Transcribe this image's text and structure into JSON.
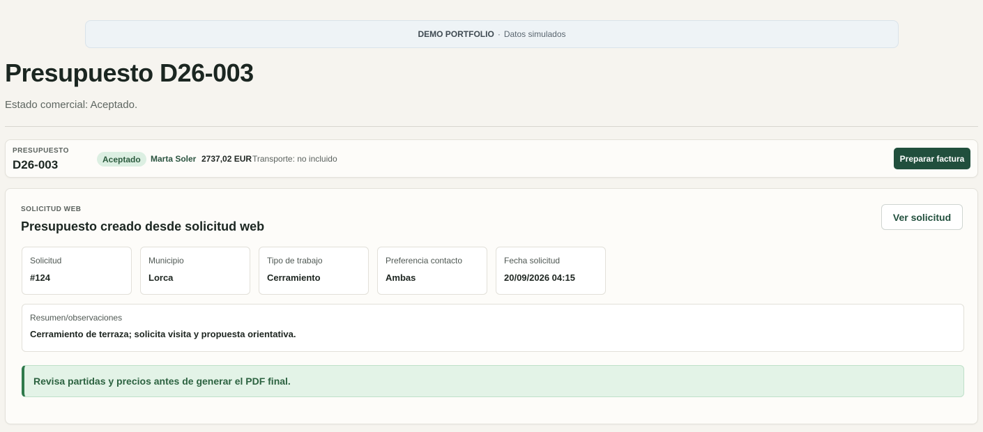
{
  "banner": {
    "strong": "DEMO PORTFOLIO",
    "separator": "·",
    "text": "Datos simulados"
  },
  "header": {
    "title": "Presupuesto D26-003",
    "subtitle": "Estado comercial: Aceptado."
  },
  "summary": {
    "kicker": "PRESUPUESTO",
    "code": "D26-003",
    "status": "Aceptado",
    "client": "Marta Soler",
    "amount": "2737,02 EUR",
    "transport": "Transporte: no incluido",
    "action_label": "Preparar factura"
  },
  "request": {
    "kicker": "SOLICITUD WEB",
    "title": "Presupuesto creado desde solicitud web",
    "action_label": "Ver solicitud",
    "fields": [
      {
        "label": "Solicitud",
        "value": "#124"
      },
      {
        "label": "Municipio",
        "value": "Lorca"
      },
      {
        "label": "Tipo de trabajo",
        "value": "Cerramiento"
      },
      {
        "label": "Preferencia contacto",
        "value": "Ambas"
      },
      {
        "label": "Fecha solicitud",
        "value": "20/09/2026 04:15"
      }
    ],
    "notes": {
      "label": "Resumen/observaciones",
      "value": "Cerramiento de terraza; solicita visita y propuesta orientativa."
    },
    "alert": "Revisa partidas y precios antes de generar el PDF final."
  },
  "colors": {
    "primary": "#214f3d",
    "badge_bg": "#dcefe2",
    "alert_bg": "#e3f3e7",
    "page_bg": "#f6f4ef"
  }
}
